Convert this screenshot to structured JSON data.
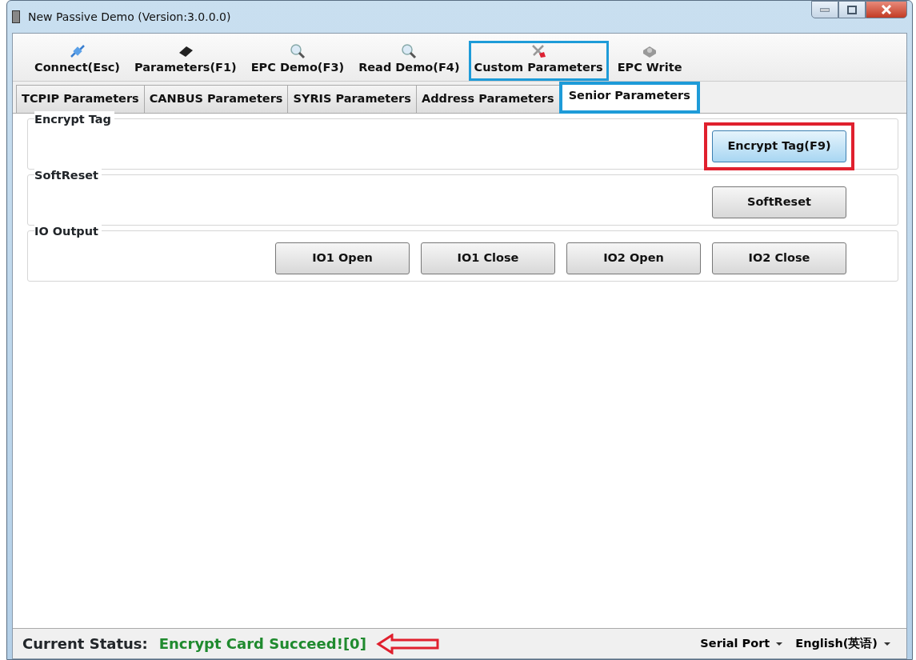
{
  "window": {
    "title": "New Passive Demo (Version:3.0.0.0)"
  },
  "toolbar": {
    "color": "#1e9bd8",
    "items": [
      {
        "label": "Connect(Esc)",
        "kind": "connect",
        "highlighted": false
      },
      {
        "label": "Parameters(F1)",
        "kind": "chip",
        "highlighted": false
      },
      {
        "label": "EPC Demo(F3)",
        "kind": "search",
        "highlighted": false
      },
      {
        "label": "Read Demo(F4)",
        "kind": "search",
        "highlighted": false
      },
      {
        "label": "Custom Parameters",
        "kind": "tools",
        "highlighted": true
      },
      {
        "label": "EPC Write",
        "kind": "disk",
        "highlighted": false
      }
    ]
  },
  "tabs": {
    "color": "#1e9bd8",
    "items": [
      {
        "label": "TCPIP Parameters",
        "selected": false,
        "highlighted": false
      },
      {
        "label": "CANBUS Parameters",
        "selected": false,
        "highlighted": false
      },
      {
        "label": "SYRIS Parameters",
        "selected": false,
        "highlighted": false
      },
      {
        "label": "Address Parameters",
        "selected": false,
        "highlighted": false
      },
      {
        "label": "Senior Parameters",
        "selected": true,
        "highlighted": true
      }
    ]
  },
  "groups": [
    {
      "title": "Encrypt Tag",
      "buttons": [
        {
          "label": "Encrypt Tag(F9)",
          "focused": true,
          "color": "#e0202e"
        }
      ]
    },
    {
      "title": "SoftReset",
      "buttons": [
        {
          "label": "SoftReset",
          "focused": false
        }
      ]
    },
    {
      "title": "IO Output",
      "buttons": [
        {
          "label": "IO1 Open",
          "focused": false
        },
        {
          "label": "IO1 Close",
          "focused": false
        },
        {
          "label": "IO2 Open",
          "focused": false
        },
        {
          "label": "IO2 Close",
          "focused": false
        }
      ]
    }
  ],
  "status_bar": {
    "label": "Current Status:",
    "message": "Encrypt Card Succeed![0]",
    "color": "#e0202e",
    "dropdowns": [
      "Serial Port",
      "English(英语)"
    ]
  }
}
